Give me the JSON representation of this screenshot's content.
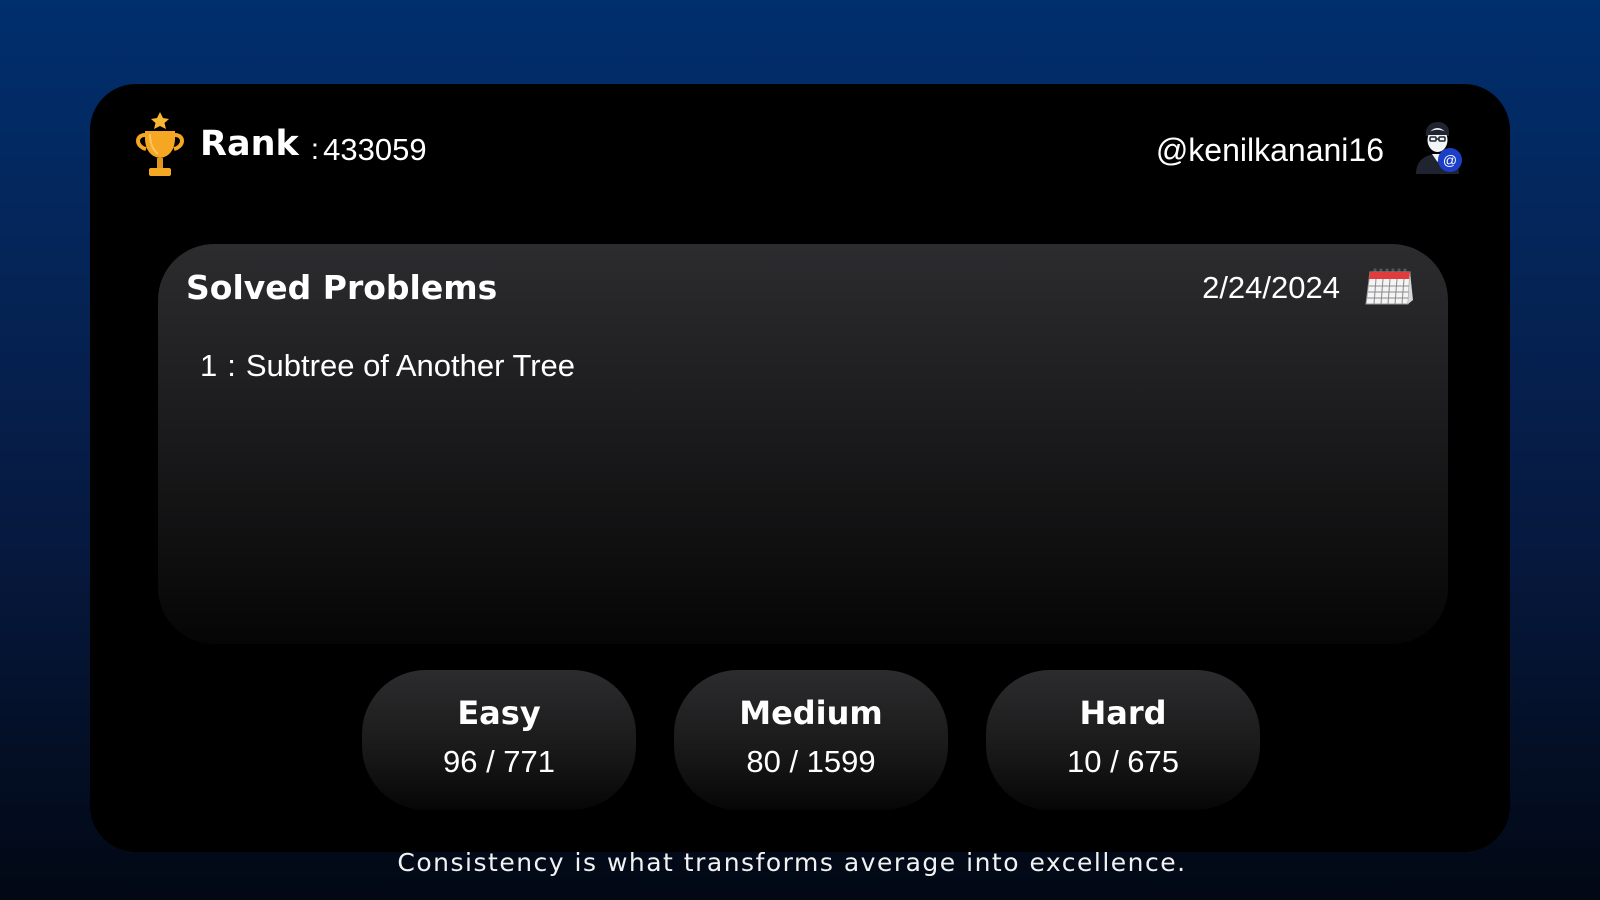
{
  "header": {
    "rank_label": "Rank",
    "rank_separator": ":",
    "rank_value": "433059",
    "username": "@kenilkanani16"
  },
  "icons": {
    "trophy": "trophy-icon",
    "user": "user-at-icon",
    "calendar": "calendar-icon"
  },
  "solved": {
    "title": "Solved Problems",
    "date": "2/24/2024",
    "problems": [
      {
        "number": "1",
        "separator": ":",
        "name": "Subtree of Another Tree"
      }
    ]
  },
  "stats": {
    "easy": {
      "label": "Easy",
      "value": "96 / 771"
    },
    "medium": {
      "label": "Medium",
      "value": "80 / 1599"
    },
    "hard": {
      "label": "Hard",
      "value": "10 / 675"
    }
  },
  "footer": {
    "quote": "Consistency is what transforms average into excellence."
  },
  "colors": {
    "background_top": "#002f6e",
    "background_bottom": "#020814",
    "card": "#000000",
    "trophy": "#f5a623",
    "text": "#ffffff"
  }
}
